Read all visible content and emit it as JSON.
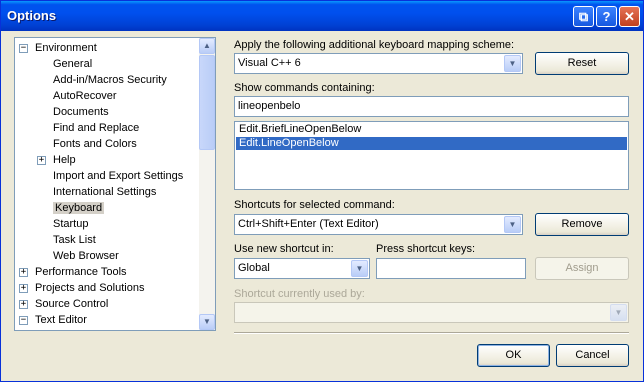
{
  "window": {
    "title": "Options"
  },
  "titlebar_buttons": {
    "help": "?",
    "close": "✕"
  },
  "tree": {
    "nodes": [
      {
        "label": "Environment",
        "level": 0,
        "expander": "−"
      },
      {
        "label": "General",
        "level": 1
      },
      {
        "label": "Add-in/Macros Security",
        "level": 1
      },
      {
        "label": "AutoRecover",
        "level": 1
      },
      {
        "label": "Documents",
        "level": 1
      },
      {
        "label": "Find and Replace",
        "level": 1
      },
      {
        "label": "Fonts and Colors",
        "level": 1
      },
      {
        "label": "Help",
        "level": 1,
        "expander": "+"
      },
      {
        "label": "Import and Export Settings",
        "level": 1
      },
      {
        "label": "International Settings",
        "level": 1
      },
      {
        "label": "Keyboard",
        "level": 1,
        "selected": true
      },
      {
        "label": "Startup",
        "level": 1
      },
      {
        "label": "Task List",
        "level": 1
      },
      {
        "label": "Web Browser",
        "level": 1
      },
      {
        "label": "Performance Tools",
        "level": 0,
        "expander": "+"
      },
      {
        "label": "Projects and Solutions",
        "level": 0,
        "expander": "+"
      },
      {
        "label": "Source Control",
        "level": 0,
        "expander": "+"
      },
      {
        "label": "Text Editor",
        "level": 0,
        "expander": "−"
      }
    ]
  },
  "mapping": {
    "label": "Apply the following additional keyboard mapping scheme:",
    "value": "Visual C++ 6",
    "reset": "Reset"
  },
  "commands": {
    "label": "Show commands containing:",
    "filter": "lineopenbelo",
    "items": [
      "Edit.BriefLineOpenBelow",
      "Edit.LineOpenBelow"
    ],
    "selected_index": 1
  },
  "shortcuts": {
    "label": "Shortcuts for selected command:",
    "value": "Ctrl+Shift+Enter (Text Editor)",
    "remove": "Remove"
  },
  "new_shortcut": {
    "use_in_label": "Use new shortcut in:",
    "use_in_value": "Global",
    "press_label": "Press shortcut keys:",
    "press_value": "",
    "assign": "Assign"
  },
  "currently_used": {
    "label": "Shortcut currently used by:",
    "value": ""
  },
  "footer": {
    "ok": "OK",
    "cancel": "Cancel"
  }
}
